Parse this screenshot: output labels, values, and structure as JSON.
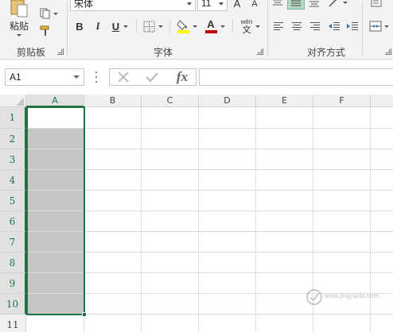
{
  "ribbon": {
    "clipboard": {
      "paste_label": "粘贴",
      "group_label": "剪贴板"
    },
    "font": {
      "font_name": "宋体",
      "font_size": "11",
      "grow_label": "A",
      "shrink_label": "A",
      "bold_label": "B",
      "italic_label": "I",
      "underline_label": "U",
      "font_color_label": "A",
      "phonetic_label": "wén",
      "phonetic_sub": "文",
      "group_label": "字体"
    },
    "alignment": {
      "group_label": "对齐方式"
    }
  },
  "formula_bar": {
    "name_box": "A1",
    "fx_label": "fx",
    "formula": ""
  },
  "grid": {
    "columns": [
      "A",
      "B",
      "C",
      "D",
      "E",
      "F"
    ],
    "rows": [
      "1",
      "2",
      "3",
      "4",
      "5",
      "6",
      "7",
      "8",
      "9",
      "10",
      "11"
    ],
    "active_cell": "A1",
    "selection": "A1:A10"
  },
  "watermark": {
    "text": "www.jingyanla.com"
  },
  "colors": {
    "accent_green": "#217346",
    "selection_fill": "#c6c6c6",
    "ribbon_bg": "#f3f3f3",
    "highlight_yellow": "#ffff00",
    "font_color_red": "#c00000"
  }
}
